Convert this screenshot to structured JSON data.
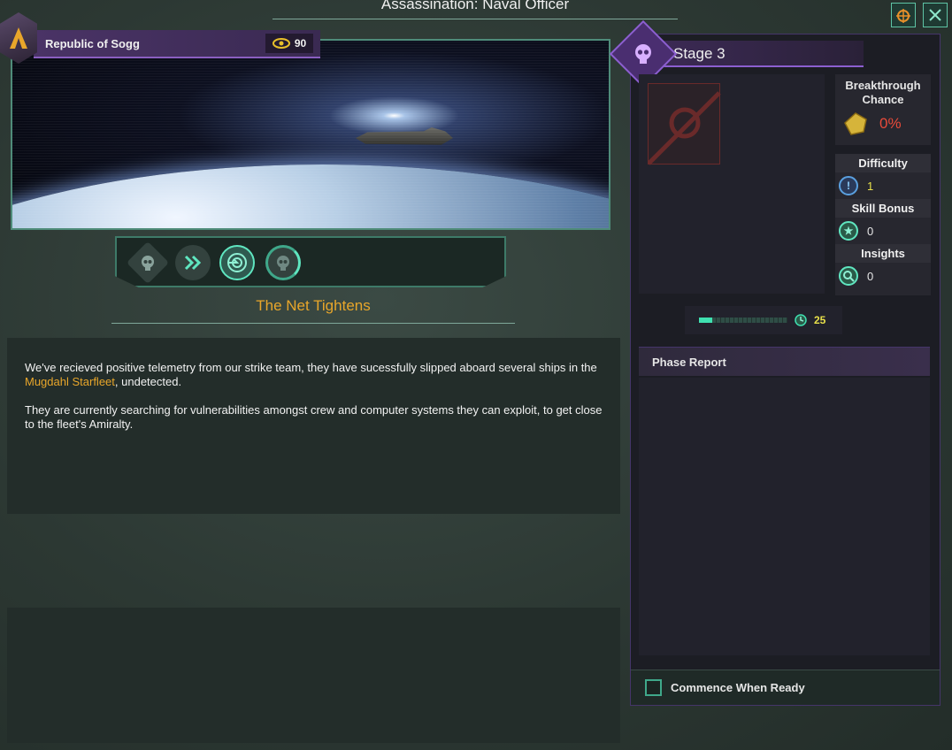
{
  "header": {
    "title": "Assassination: Naval Officer"
  },
  "top_buttons": [
    {
      "icon": "camera-target-icon"
    },
    {
      "icon": "close-icon"
    }
  ],
  "empire": {
    "name": "Republic of Sogg",
    "intel_value": "90",
    "intel_icon": "eye-icon"
  },
  "stages": [
    {
      "icon": "skull-icon",
      "state": "done"
    },
    {
      "icon": "chevron-double-right-icon",
      "state": "done"
    },
    {
      "icon": "target-radar-icon",
      "state": "current"
    },
    {
      "icon": "skull-icon",
      "state": "future"
    }
  ],
  "phase": {
    "name": "The Net Tightens",
    "description_1_pre": "We've recieved positive telemetry from our strike team, they have sucessfully slipped aboard several ships in the ",
    "description_1_highlight": "Mugdahl Starfleet",
    "description_1_post": ", undetected.",
    "description_2": "They are currently searching for vulnerabilities amongst crew and computer systems they can exploit, to get close to the fleet's Amiralty."
  },
  "right": {
    "stage_label": "Stage 3",
    "breakthrough_label": "Breakthrough Chance",
    "breakthrough_value": "0%",
    "difficulty_label": "Difficulty",
    "difficulty_value": "1",
    "skill_bonus_label": "Skill Bonus",
    "skill_bonus_value": "0",
    "insights_label": "Insights",
    "insights_value": "0",
    "progress_value": "25",
    "progress_fraction": 0.15,
    "phase_report_label": "Phase Report",
    "commence_label": "Commence When Ready",
    "commence_checked": false
  },
  "colors": {
    "accent_gold": "#e8a62a",
    "danger": "#e84a3a",
    "teal": "#3fe0b0",
    "purple": "#8c5fd0"
  }
}
